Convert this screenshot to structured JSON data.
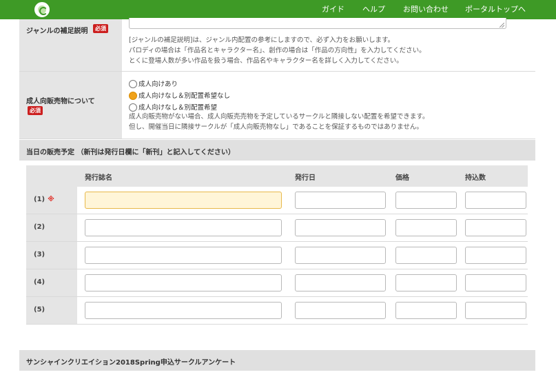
{
  "header": {
    "nav": [
      "ガイド",
      "ヘルプ",
      "お問い合わせ",
      "ポータルトップへ"
    ],
    "bg_color": "#3e9a26"
  },
  "genre_note": {
    "label": "ジャンルの補足説明",
    "required": "必須",
    "help": [
      "[ジャンルの補足説明]は、ジャンル内配置の参考にしますので、必ず入力をお願いします。",
      "パロディの場合は「作品名とキャラクター名」、創作の場合は「作品の方向性」を入力してください。",
      "とくに登場人数が多い作品を扱う場合、作品名やキャラクター名を詳しく入力してください。"
    ]
  },
  "adult": {
    "label": "成人向販売物について",
    "required": "必須",
    "options": [
      "成人向けあり",
      "成人向けなし＆別配置希望なし",
      "成人向けなし＆別配置希望"
    ],
    "selected_index": 1,
    "help": [
      "成人向販売物がない場合、成人向販売売物を予定しているサークルと隣接しない配置を希望できます。",
      "但し、開催当日に隣接サークルが「成人向販売物なし」であることを保証するものではありません。"
    ]
  },
  "sales": {
    "title": "当日の販売予定 （新刊は発行日欄に「新刊」と記入してください）",
    "columns": [
      "発行誌名",
      "発行日",
      "価格",
      "持込数"
    ],
    "rows": [
      {
        "label": "(1)",
        "mark": "※"
      },
      {
        "label": "(2)",
        "mark": ""
      },
      {
        "label": "(3)",
        "mark": ""
      },
      {
        "label": "(4)",
        "mark": ""
      },
      {
        "label": "(5)",
        "mark": ""
      }
    ]
  },
  "survey": {
    "title": "サンシャインクリエイション2018Spring申込サークルアンケート"
  }
}
